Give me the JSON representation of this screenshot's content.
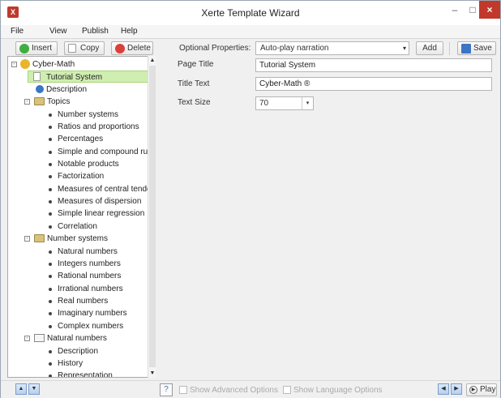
{
  "window": {
    "title": "Xerte Template Wizard",
    "app_icon": "X",
    "minimize": "–",
    "maximize": "□",
    "close": "×"
  },
  "menu": [
    "File",
    "View",
    "Publish",
    "Help"
  ],
  "toolbar": {
    "insert": "Insert",
    "copy": "Copy",
    "delete": "Delete",
    "optional_properties_label": "Optional Properties:",
    "optional_properties_value": "Auto-play narration",
    "add": "Add",
    "save": "Save"
  },
  "tree": {
    "root": "Cyber-Math",
    "selected": "Tutorial System",
    "description": "Description",
    "topics_folder": "Topics",
    "topics": [
      "Number systems",
      "Ratios and proportions",
      "Percentages",
      "Simple and compound rul",
      "Notable products",
      "Factorization",
      "Measures of central tende",
      "Measures of dispersion",
      "Simple linear regression",
      "Correlation"
    ],
    "number_systems_folder": "Number systems",
    "number_systems": [
      "Natural numbers",
      "Integers numbers",
      "Rational numbers",
      "Irrational numbers",
      "Real numbers",
      "Imaginary numbers",
      "Complex numbers"
    ],
    "natural_numbers_node": "Natural numbers",
    "natural_numbers": [
      "Description",
      "History",
      "Representation"
    ]
  },
  "properties": {
    "page_title_label": "Page Title",
    "page_title_value": "Tutorial System",
    "title_text_label": "Title Text",
    "title_text_value": "Cyber-Math ®",
    "text_size_label": "Text Size",
    "text_size_value": "70"
  },
  "bottom": {
    "show_advanced": "Show Advanced Options",
    "show_language": "Show Language Options",
    "play": "Play"
  }
}
